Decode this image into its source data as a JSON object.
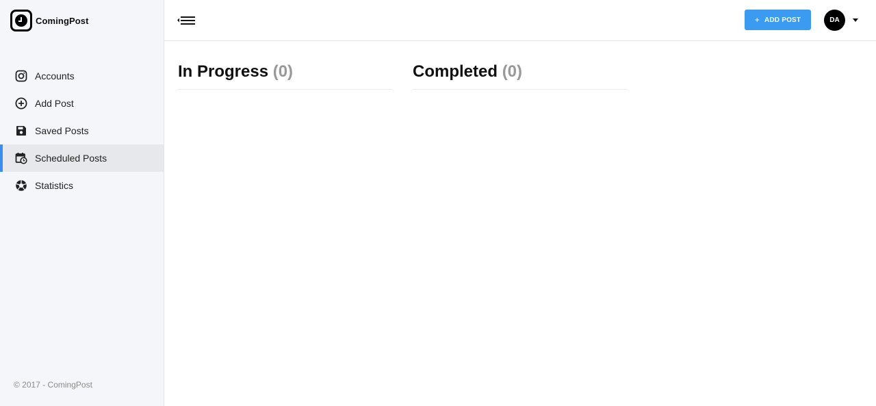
{
  "brand": {
    "name": "ComingPost"
  },
  "sidebar": {
    "items": [
      {
        "label": "Accounts",
        "icon": "instagram-icon",
        "active": false
      },
      {
        "label": "Add Post",
        "icon": "plus-circle-icon",
        "active": false
      },
      {
        "label": "Saved Posts",
        "icon": "save-icon",
        "active": false
      },
      {
        "label": "Scheduled Posts",
        "icon": "calendar-clock-icon",
        "active": true
      },
      {
        "label": "Statistics",
        "icon": "aperture-icon",
        "active": false
      }
    ],
    "footer": "© 2017 - ComingPost"
  },
  "header": {
    "menu_icon": "collapse-menu-icon",
    "add_post_label": "ADD POST",
    "add_post_icon": "+",
    "avatar_initials": "DA"
  },
  "main": {
    "columns": [
      {
        "title": "In Progress",
        "count": "(0)"
      },
      {
        "title": "Completed",
        "count": "(0)"
      }
    ]
  },
  "colors": {
    "accent": "#3a9bf0",
    "active_bar": "#3a8ef0",
    "sidebar_bg": "#f5f6fa",
    "count_gray": "#999999"
  }
}
